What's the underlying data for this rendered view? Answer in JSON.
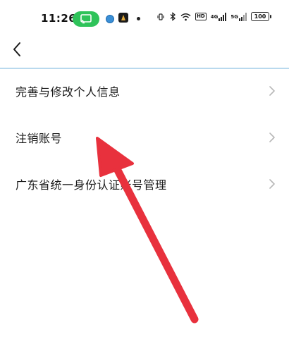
{
  "status_bar": {
    "time": "11:26",
    "battery": "100",
    "network_4g": "4G",
    "network_5g": "5G",
    "hd_label": "HD"
  },
  "header": {
    "back_icon": "chevron-left-icon"
  },
  "menu": {
    "items": [
      {
        "label": "完善与修改个人信息"
      },
      {
        "label": "注销账号"
      },
      {
        "label": "广东省统一身份认证账号管理"
      }
    ]
  },
  "colors": {
    "cast_pill": "#2fc35a",
    "divider": "#b9d9ee",
    "annotation_arrow": "#e8313d",
    "chevron": "#b8b8b8"
  }
}
